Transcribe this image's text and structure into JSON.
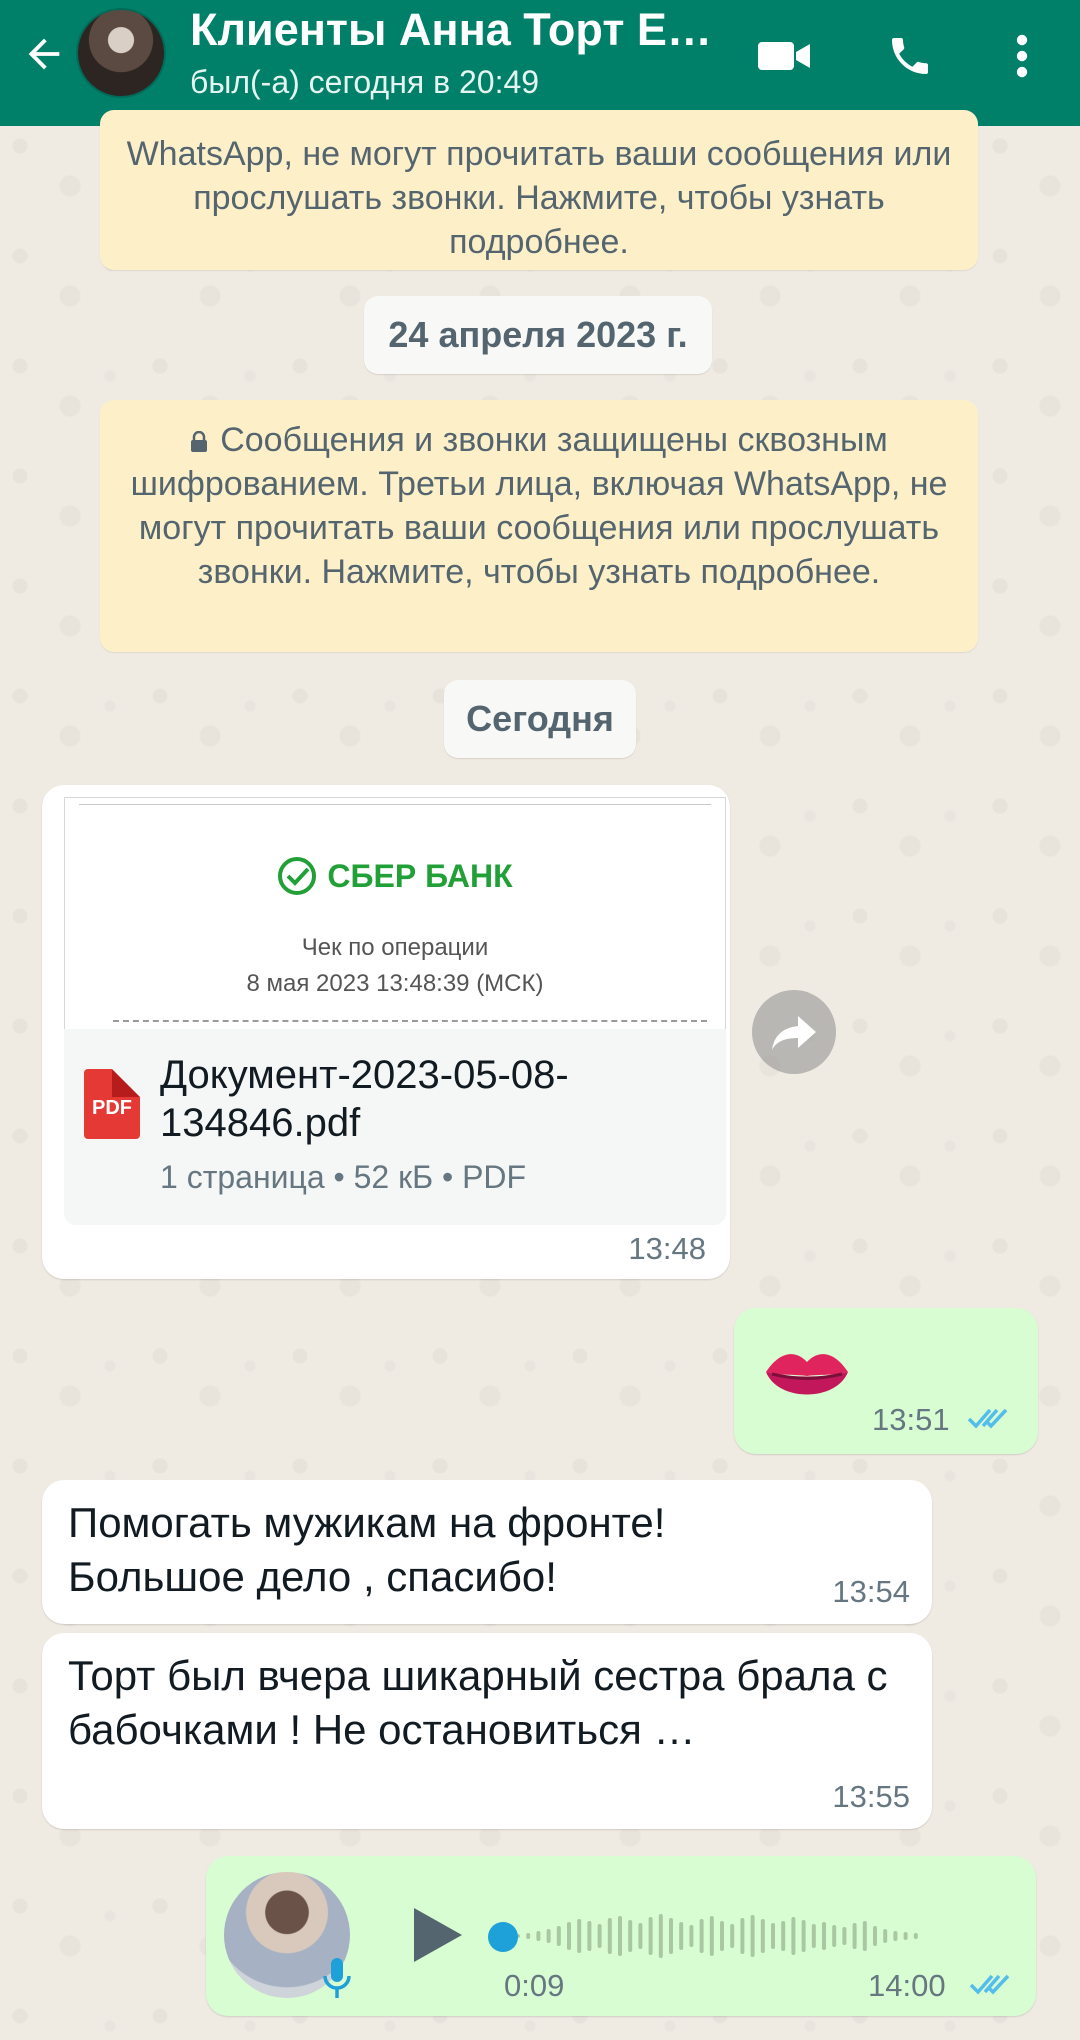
{
  "header": {
    "title": "Клиенты Анна Торт Ед...",
    "subtitle": "был(-а) сегодня в 20:49",
    "bg_color": "#008069"
  },
  "notice_top": {
    "text": "WhatsApp, не могут прочитать ваши сообщения или прослушать звонки. Нажмите, чтобы узнать подробнее."
  },
  "date_pill_1": "24 апреля 2023 г.",
  "notice_main": {
    "text": "Сообщения и звонки защищены сквозным шифрованием. Третьи лица, включая WhatsApp, не могут прочитать ваши сообщения или прослушать звонки. Нажмите, чтобы узнать подробнее."
  },
  "date_pill_2": "Сегодня",
  "messages": [
    {
      "type": "document",
      "direction": "incoming",
      "preview": {
        "bank_name": "СБЕР БАНК",
        "line1": "Чек по операции",
        "line2": "8 мая 2023 13:48:39 (МСК)"
      },
      "file_icon_label": "PDF",
      "file_name": "Документ-2023-05-08-134846.pdf",
      "file_meta": "1 страница • 52 кБ • PDF",
      "time": "13:48"
    },
    {
      "type": "sticker",
      "direction": "outgoing",
      "icon": "lips-kiss",
      "time": "13:51",
      "status": "read"
    },
    {
      "type": "text",
      "direction": "incoming",
      "text": "Помогать мужикам на фронте! Большое дело , спасибо!",
      "time": "13:54"
    },
    {
      "type": "text",
      "direction": "incoming",
      "text": "Торт был вчера шикарный сестра брала с бабочками ! Не остановиться …",
      "time": "13:55"
    },
    {
      "type": "voice",
      "direction": "outgoing",
      "duration": "0:09",
      "time": "14:00",
      "status": "read"
    }
  ],
  "colors": {
    "incoming_bubble": "#ffffff",
    "outgoing_bubble": "#d9fdd3",
    "read_ticks": "#53bdeb",
    "notice_bg": "#fdf0c9",
    "chat_bg": "#efeae2"
  }
}
